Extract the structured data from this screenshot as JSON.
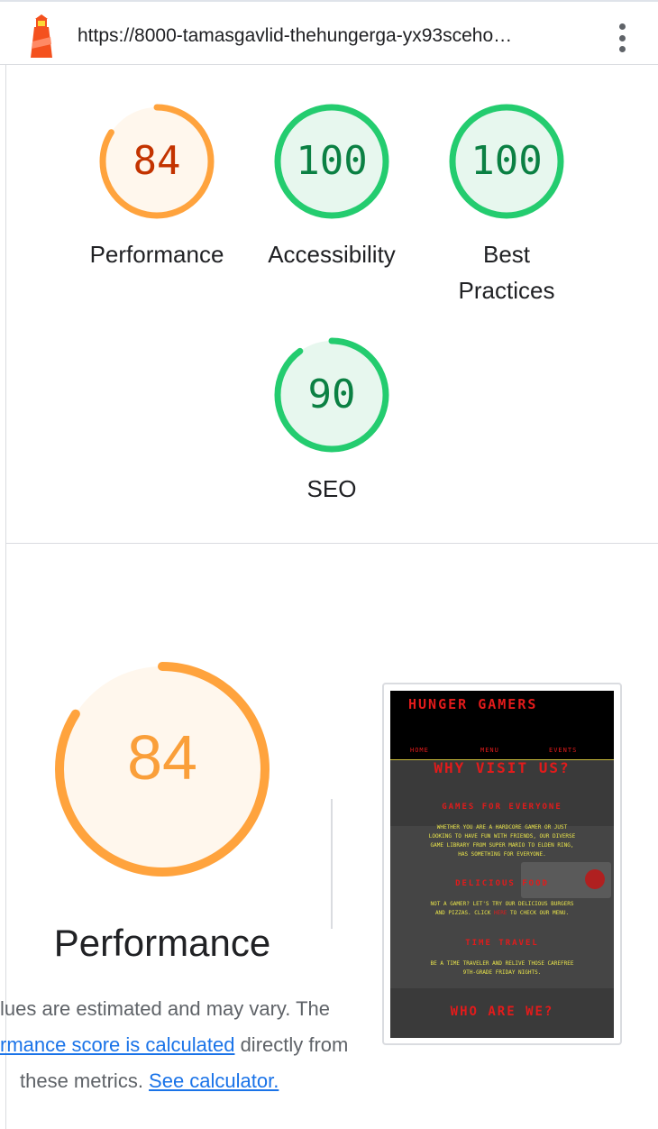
{
  "browser": {
    "url": "https://8000-tamasgavlid-thehungerga-yx93sceho…",
    "menu_icon": "kebab-menu-icon",
    "favicon": "lighthouse-icon"
  },
  "scores": [
    {
      "value": "84",
      "label": "Performance",
      "score": 0.84,
      "color": "#ffa33d"
    },
    {
      "value": "100",
      "label": "Accessibility",
      "score": 1.0,
      "color": "#24cc6f"
    },
    {
      "value": "100",
      "label_line1": "Best",
      "label_line2": "Practices",
      "score": 1.0,
      "color": "#24cc6f"
    },
    {
      "value": "90",
      "label": "SEO",
      "score": 0.9,
      "color": "#24cc6f"
    }
  ],
  "performance": {
    "value": "84",
    "score": 0.84,
    "label": "Performance",
    "desc_line1": "lues are estimated and may vary. The",
    "desc_link1": "rmance score is calculated",
    "desc_line2_rest": " directly from",
    "desc_line3": "these metrics. ",
    "desc_link2": "See calculator."
  },
  "thumbnail": {
    "site_title": "HUNGER GAMERS",
    "nav": [
      "HOME",
      "MENU",
      "EVENTS"
    ],
    "heading": "WHY VISIT US?",
    "s1_title": "GAMES FOR EVERYONE",
    "s1_l1": "WHETHER YOU ARE A HARDCORE GAMER OR JUST",
    "s1_l2": "LOOKING TO HAVE FUN WITH FRIENDS, OUR DIVERSE",
    "s1_l3": "GAME LIBRARY FROM SUPER MARIO TO ELDEN RING,",
    "s1_l4": "HAS SOMETHING FOR EVERYONE.",
    "s2_title": "DELICIOUS FOOD",
    "s2_l1": "NOT A GAMER? LET'S TRY OUR DELICIOUS BURGERS",
    "s2_l2a": "AND PIZZAS. CLICK ",
    "s2_link": "HERE",
    "s2_l2b": " TO CHECK OUR MENU.",
    "s3_title": "TIME TRAVEL",
    "s3_l1": "BE A TIME TRAVELER AND RELIVE THOSE CAREFREE",
    "s3_l2": "9TH-GRADE FRIDAY NIGHTS.",
    "footer_heading": "WHO ARE WE?"
  }
}
